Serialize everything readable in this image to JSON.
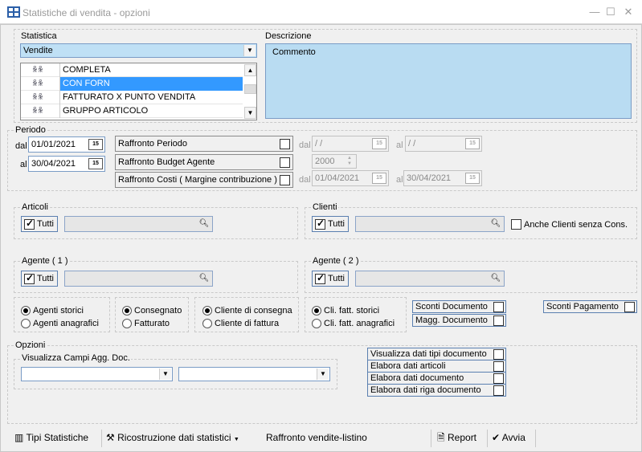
{
  "window": {
    "title": "Statistiche di vendita - opzioni",
    "minimize": "—",
    "maximize": "☐",
    "close": "✕"
  },
  "statistica": {
    "label": "Statistica",
    "selected": "Vendite",
    "items": [
      {
        "label": "COMPLETA",
        "selected": false
      },
      {
        "label": "CON FORN",
        "selected": true
      },
      {
        "label": "FATTURATO X PUNTO VENDITA",
        "selected": false
      },
      {
        "label": "GRUPPO ARTICOLO",
        "selected": false
      }
    ]
  },
  "descrizione": {
    "label": "Descrizione",
    "value": "Commento"
  },
  "periodo": {
    "label": "Periodo",
    "dal_label": "dal",
    "al_label": "al",
    "dal_value": "01/01/2021",
    "al_value": "30/04/2021",
    "cal_icon": "15",
    "raffronto_periodo": "Raffronto Periodo",
    "raffronto_budget": "Raffronto Budget Agente",
    "raffronto_costi": "Raffronto Costi ( Margine contribuzione )",
    "rp_dal_label": "dal",
    "rp_al_label": "al",
    "rp_dal_value": " / /",
    "rp_al_value": " / /",
    "budget_year": "2000",
    "rc_dal_label": "dal",
    "rc_al_label": "al",
    "rc_dal_value": "01/04/2021",
    "rc_al_value": "30/04/2021"
  },
  "articoli": {
    "label": "Articoli",
    "tutti": "Tutti",
    "tutti_checked": true
  },
  "clienti": {
    "label": "Clienti",
    "tutti": "Tutti",
    "tutti_checked": true,
    "anche_label": "Anche Clienti senza Cons."
  },
  "agente1": {
    "label": "Agente ( 1 )",
    "tutti": "Tutti",
    "tutti_checked": true
  },
  "agente2": {
    "label": "Agente ( 2 )",
    "tutti": "Tutti",
    "tutti_checked": true
  },
  "radio_groups": {
    "agenti": [
      "Agenti storici",
      "Agenti anagrafici"
    ],
    "consegna": [
      "Consegnato",
      "Fatturato"
    ],
    "cliente": [
      "Cliente di consegna",
      "Cliente di fattura"
    ],
    "fatt": [
      "Cli. fatt. storici",
      "Cli. fatt. anagrafici"
    ]
  },
  "sconti": {
    "sconti_documento": "Sconti Documento",
    "magg_documento": "Magg. Documento",
    "sconti_pagamento": "Sconti Pagamento"
  },
  "opzioni": {
    "label": "Opzioni",
    "visualizza_campi": "Visualizza Campi Agg. Doc.",
    "checks": [
      "Visualizza dati tipi documento",
      "Elabora dati articoli",
      "Elabora dati documento",
      "Elabora dati riga documento"
    ]
  },
  "toolbar": {
    "tipi": "Tipi Statistiche",
    "ricostruzione": "Ricostruzione dati statistici",
    "raffronto": "Raffronto vendite-listino",
    "report": "Report",
    "avvia": "Avvia"
  },
  "colors": {
    "accent": "#3399ff",
    "desc_bg": "#b9dcf2",
    "combo_bg": "#bfe0f5"
  }
}
